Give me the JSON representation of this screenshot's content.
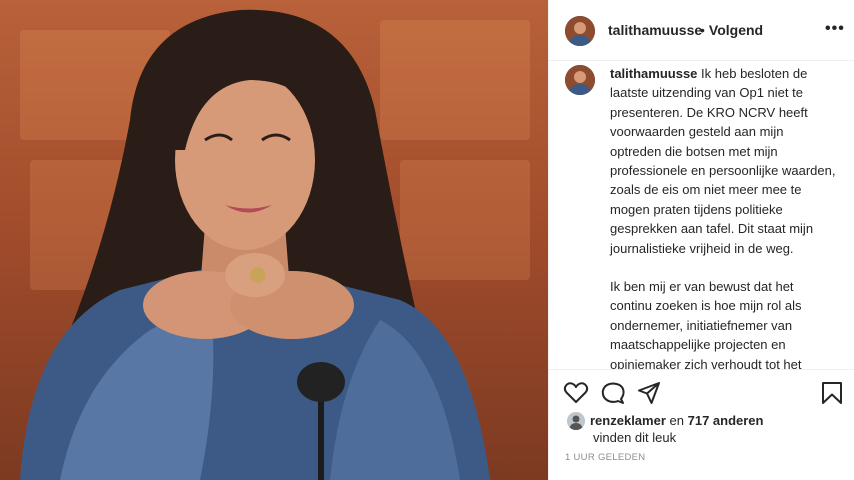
{
  "post": {
    "username": "talithamuusse",
    "follow_dot": "•",
    "follow_label": "Volgend",
    "more_label": "•••"
  },
  "caption": {
    "username": "talithamuusse",
    "paragraph1": "Ik heb besloten de laatste uitzending van Op1 niet te presenteren. De KRO NCRV heeft voorwaarden gesteld aan mijn optreden die botsen met mijn professionele en persoonlijke waarden, zoals de eis om niet meer mee te mogen praten tijdens politieke gesprekken aan tafel. Dit staat mijn journalistieke vrijheid in de weg.",
    "paragraph2": "Ik ben mij er van bewust dat het continu zoeken is hoe mijn rol als ondernemer, initiatiefnemer van maatschappelijke projecten en opiniemaker zich verhoudt tot het presenteren van een journalistiek programma. En dit is dan ook"
  },
  "actions": {
    "like_icon": "heart-icon",
    "comment_icon": "comment-icon",
    "share_icon": "share-icon",
    "save_icon": "bookmark-icon"
  },
  "likes": {
    "user": "renzeklamer",
    "joiner": "en",
    "others": "717 anderen",
    "suffix": "vinden dit leuk"
  },
  "timestamp": "1 UUR GELEDEN"
}
